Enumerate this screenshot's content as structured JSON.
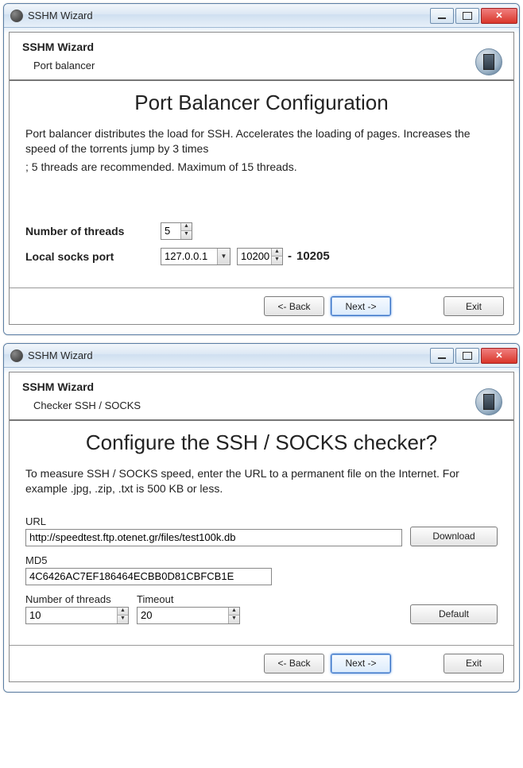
{
  "window1": {
    "title": "SSHM Wizard",
    "header": {
      "wizard_title": "SSHM Wizard",
      "subtitle": "Port balancer"
    },
    "page_heading": "Port Balancer Configuration",
    "description_line1": "Port balancer distributes the load for SSH. Accelerates the loading of pages. Increases the speed of the torrents jump by 3 times",
    "description_line2": "; 5 threads are recommended. Maximum of 15 threads.",
    "labels": {
      "num_threads": "Number of threads",
      "local_socks": "Local socks port"
    },
    "values": {
      "num_threads": "5",
      "socks_host": "127.0.0.1",
      "socks_port": "10200",
      "socks_port_end": "10205"
    },
    "buttons": {
      "back": "<- Back",
      "next": "Next ->",
      "exit": "Exit"
    }
  },
  "window2": {
    "title": "SSHM Wizard",
    "header": {
      "wizard_title": "SSHM Wizard",
      "subtitle": "Checker SSH / SOCKS"
    },
    "page_heading": "Configure the SSH / SOCKS checker?",
    "description": "To measure SSH / SOCKS speed, enter the URL to a permanent file on the Internet. For example .jpg, .zip, .txt is 500 KB or less.",
    "labels": {
      "url": "URL",
      "md5": "MD5",
      "num_threads": "Number of threads",
      "timeout": "Timeout"
    },
    "values": {
      "url": "http://speedtest.ftp.otenet.gr/files/test100k.db",
      "md5": "4C6426AC7EF186464ECBB0D81CBFCB1E",
      "num_threads": "10",
      "timeout": "20"
    },
    "buttons": {
      "download": "Download",
      "default": "Default",
      "back": "<- Back",
      "next": "Next ->",
      "exit": "Exit"
    }
  }
}
